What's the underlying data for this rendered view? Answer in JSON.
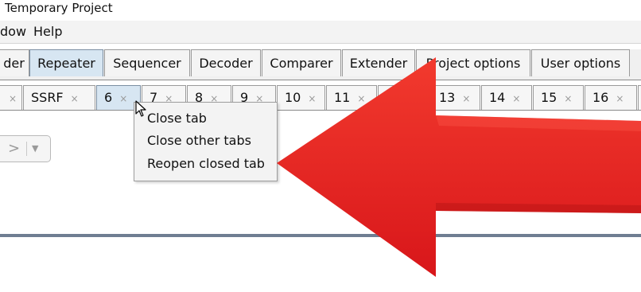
{
  "window": {
    "title": "Temporary Project"
  },
  "menu": {
    "items": [
      "dow",
      "Help"
    ]
  },
  "main_tabs": [
    {
      "label": "der"
    },
    {
      "label": "Repeater"
    },
    {
      "label": "Sequencer"
    },
    {
      "label": "Decoder"
    },
    {
      "label": "Comparer"
    },
    {
      "label": "Extender"
    },
    {
      "label": "Project options"
    },
    {
      "label": "User options"
    }
  ],
  "repeater_tabs": [
    {
      "label": ""
    },
    {
      "label": "SSRF"
    },
    {
      "label": "6"
    },
    {
      "label": "7"
    },
    {
      "label": "8"
    },
    {
      "label": "9"
    },
    {
      "label": "10"
    },
    {
      "label": "11"
    },
    {
      "label": ""
    },
    {
      "label": "13"
    },
    {
      "label": "14"
    },
    {
      "label": "15"
    },
    {
      "label": "16"
    }
  ],
  "close_glyph": "×",
  "nav": {
    "forward_glyph": ">",
    "dropdown_glyph": "▼"
  },
  "context_menu": {
    "items": [
      {
        "label": "Close tab"
      },
      {
        "label": "Close other tabs"
      },
      {
        "label": "Reopen closed tab"
      }
    ]
  },
  "colors": {
    "annotation_arrow": "#e0191b",
    "active_tab": "#d7e6f2"
  },
  "icons": {
    "pointer": "mouse-pointer-icon",
    "annotation": "red-arrow-icon"
  }
}
